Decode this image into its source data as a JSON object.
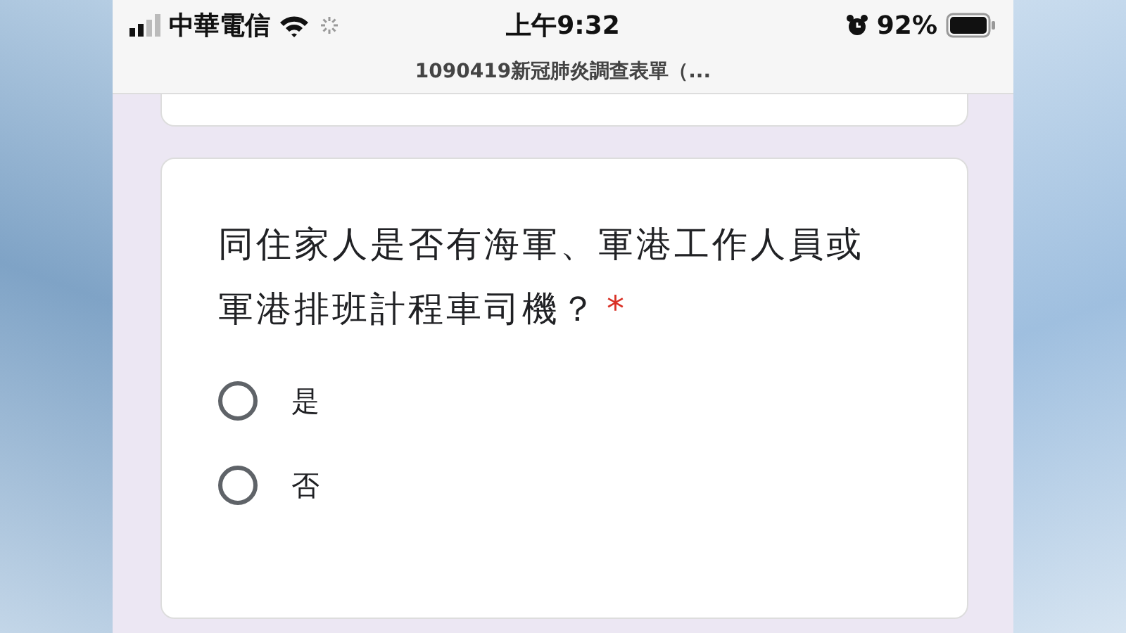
{
  "status_bar": {
    "carrier": "中華電信",
    "time": "上午9:32",
    "battery": "92%"
  },
  "address_bar": {
    "title": "1090419新冠肺炎調查表單（..."
  },
  "question": {
    "text": "同住家人是否有海軍、軍港工作人員或軍港排班計程車司機？",
    "required_mark": "*",
    "options": [
      {
        "label": "是",
        "selected": false
      },
      {
        "label": "否",
        "selected": false
      }
    ]
  }
}
